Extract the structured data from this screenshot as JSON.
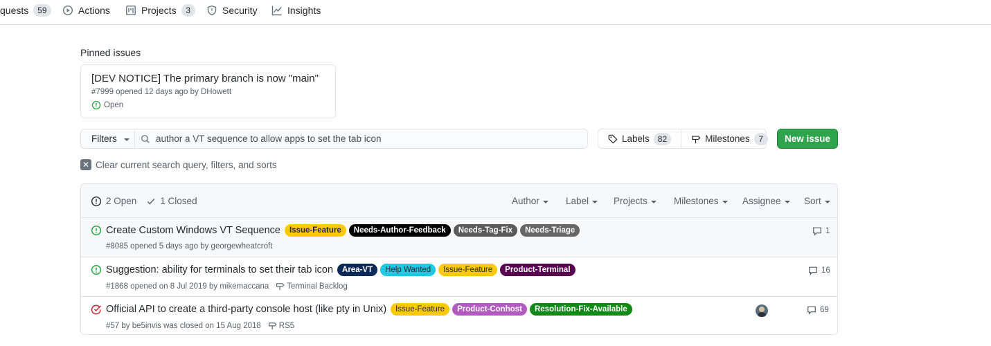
{
  "nav": {
    "pull_requests": {
      "label": "quests",
      "count": "59"
    },
    "actions": {
      "label": "Actions"
    },
    "projects": {
      "label": "Projects",
      "count": "3"
    },
    "security": {
      "label": "Security"
    },
    "insights": {
      "label": "Insights"
    }
  },
  "pinned": {
    "heading": "Pinned issues",
    "card": {
      "title": "[DEV NOTICE] The primary branch is now \"main\"",
      "meta": "#7999 opened 12 days ago by DHowett",
      "state": "Open"
    }
  },
  "toolbar": {
    "filters_label": "Filters",
    "search_value": "author a VT sequence to allow apps to set the tab icon",
    "labels_label": "Labels",
    "labels_count": "82",
    "milestones_label": "Milestones",
    "milestones_count": "7",
    "new_issue_label": "New issue",
    "clear_label": "Clear current search query, filters, and sorts"
  },
  "list_header": {
    "open_label": "2 Open",
    "closed_label": "1 Closed",
    "author": "Author",
    "label": "Label",
    "projects": "Projects",
    "milestones": "Milestones",
    "assignee": "Assignee",
    "sort": "Sort"
  },
  "colors": {
    "open_green": "#28a745",
    "closed_red": "#cb2431",
    "primary_button": "#2ea44f"
  },
  "issues": [
    {
      "state": "open",
      "title": "Create Custom Windows VT Sequence",
      "labels": [
        {
          "text": "Issue-Feature",
          "bg": "#fbca04",
          "fg": "#24292e"
        },
        {
          "text": "Needs-Author-Feedback",
          "bg": "#000000",
          "fg": "#ffffff"
        },
        {
          "text": "Needs-Tag-Fix",
          "bg": "#5a5a5a",
          "fg": "#ffffff"
        },
        {
          "text": "Needs-Triage",
          "bg": "#666666",
          "fg": "#ffffff"
        }
      ],
      "meta": "#8085 opened 5 days ago by georgewheatcroft",
      "milestone": "",
      "comments": "1"
    },
    {
      "state": "open",
      "title": "Suggestion: ability for terminals to set their tab icon",
      "labels": [
        {
          "text": "Area-VT",
          "bg": "#0b2a57",
          "fg": "#ffffff"
        },
        {
          "text": "Help Wanted",
          "bg": "#1fc8e3",
          "fg": "#24292e"
        },
        {
          "text": "Issue-Feature",
          "bg": "#fbca04",
          "fg": "#24292e"
        },
        {
          "text": "Product-Terminal",
          "bg": "#5a0050",
          "fg": "#ffffff"
        }
      ],
      "meta": "#1868 opened on 8 Jul 2019 by mikemaccana",
      "milestone": "Terminal Backlog",
      "comments": "16"
    },
    {
      "state": "closed",
      "title": "Official API to create a third-party console host (like pty in Unix)",
      "labels": [
        {
          "text": "Issue-Feature",
          "bg": "#fbca04",
          "fg": "#24292e"
        },
        {
          "text": "Product-Conhost",
          "bg": "#b35ac2",
          "fg": "#ffffff"
        },
        {
          "text": "Resolution-Fix-Available",
          "bg": "#0e8a16",
          "fg": "#ffffff"
        }
      ],
      "meta": "#57 by be5invis was closed on 15 Aug 2018",
      "milestone": "RS5",
      "comments": "69"
    }
  ]
}
